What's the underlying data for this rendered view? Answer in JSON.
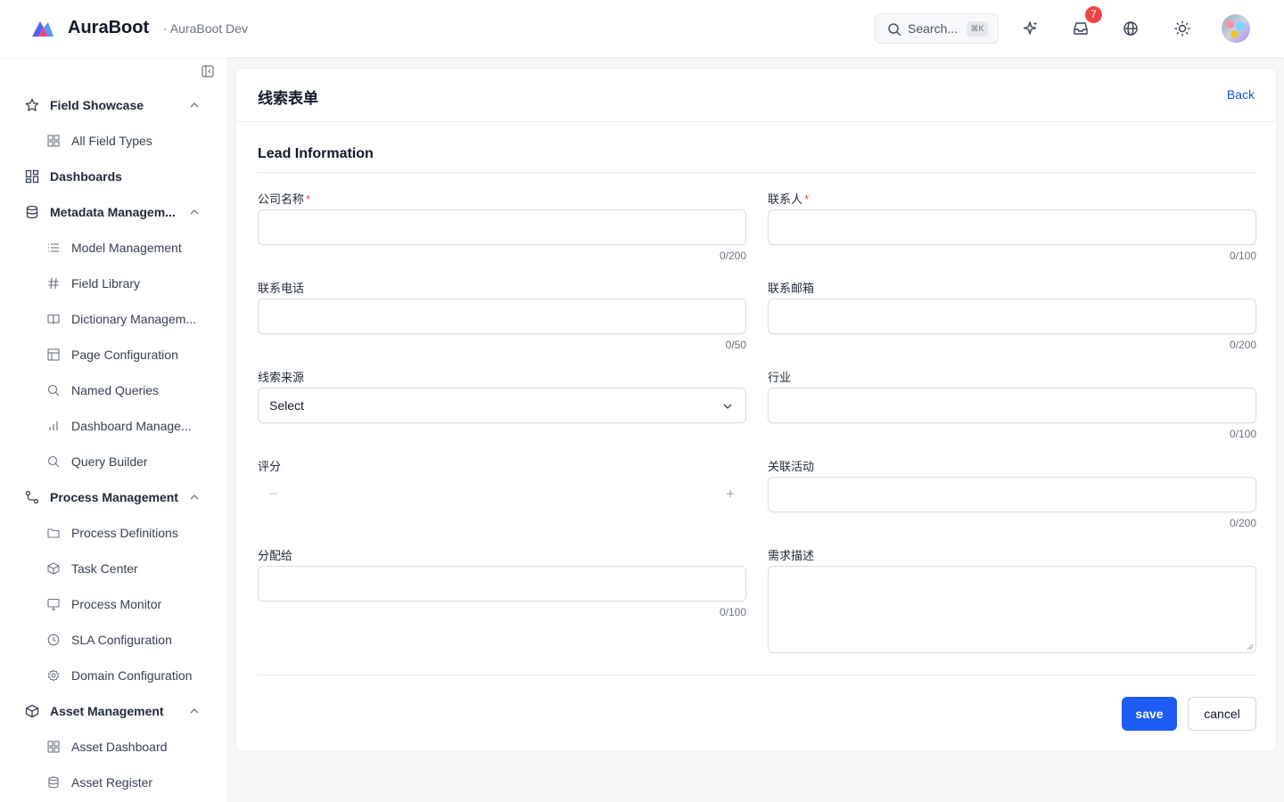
{
  "header": {
    "brand": "AuraBoot",
    "environment": "· AuraBoot Dev",
    "search_placeholder": "Search...",
    "search_shortcut": "⌘K",
    "notification_count": "7",
    "icons": [
      "sparkles-icon",
      "inbox-icon",
      "globe-icon",
      "sun-icon"
    ]
  },
  "sidebar": {
    "items": [
      {
        "label": "Field Showcase",
        "icon": "star-icon",
        "level": "top",
        "expanded": true
      },
      {
        "label": "All Field Types",
        "icon": "grid-icon",
        "level": "sub"
      },
      {
        "label": "Dashboards",
        "icon": "dashboard-icon",
        "level": "top"
      },
      {
        "label": "Metadata Managem...",
        "icon": "database-icon",
        "level": "top",
        "expanded": true
      },
      {
        "label": "Model Management",
        "icon": "list-icon",
        "level": "sub"
      },
      {
        "label": "Field Library",
        "icon": "hash-icon",
        "level": "sub"
      },
      {
        "label": "Dictionary Managem...",
        "icon": "book-icon",
        "level": "sub"
      },
      {
        "label": "Page Configuration",
        "icon": "layout-icon",
        "level": "sub"
      },
      {
        "label": "Named Queries",
        "icon": "search-icon",
        "level": "sub"
      },
      {
        "label": "Dashboard Manage...",
        "icon": "bar-chart-icon",
        "level": "sub"
      },
      {
        "label": "Query Builder",
        "icon": "search-icon",
        "level": "sub"
      },
      {
        "label": "Process Management",
        "icon": "route-icon",
        "level": "top",
        "expanded": true
      },
      {
        "label": "Process Definitions",
        "icon": "folder-icon",
        "level": "sub"
      },
      {
        "label": "Task Center",
        "icon": "box-icon",
        "level": "sub"
      },
      {
        "label": "Process Monitor",
        "icon": "monitor-icon",
        "level": "sub"
      },
      {
        "label": "SLA Configuration",
        "icon": "clock-icon",
        "level": "sub"
      },
      {
        "label": "Domain Configuration",
        "icon": "gear-icon",
        "level": "sub"
      },
      {
        "label": "Asset Management",
        "icon": "package-icon",
        "level": "top",
        "expanded": true
      },
      {
        "label": "Asset Dashboard",
        "icon": "grid-icon",
        "level": "sub"
      },
      {
        "label": "Asset Register",
        "icon": "database-icon",
        "level": "sub"
      }
    ]
  },
  "form": {
    "title": "线索表单",
    "back_label": "Back",
    "section_title": "Lead Information",
    "fields": {
      "company": {
        "label": "公司名称",
        "required": "*",
        "counter": "0/200"
      },
      "contact": {
        "label": "联系人",
        "required": "*",
        "counter": "0/100"
      },
      "phone": {
        "label": "联系电话",
        "counter": "0/50"
      },
      "email": {
        "label": "联系邮箱",
        "counter": "0/200"
      },
      "source": {
        "label": "线索来源",
        "value": "Select"
      },
      "industry": {
        "label": "行业",
        "counter": "0/100"
      },
      "score": {
        "label": "评分"
      },
      "activity": {
        "label": "关联活动",
        "counter": "0/200"
      },
      "assignee": {
        "label": "分配给",
        "counter": "0/100"
      },
      "description": {
        "label": "需求描述"
      }
    },
    "save_label": "save",
    "cancel_label": "cancel"
  },
  "colors": {
    "primary": "#1d5cf5",
    "link": "#1d4ed8",
    "required": "#ef4444",
    "badge": "#ef4444"
  }
}
